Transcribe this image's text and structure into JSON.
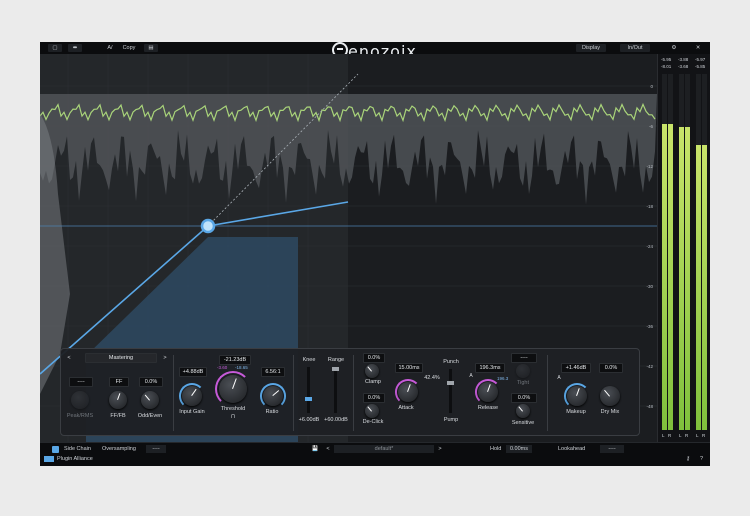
{
  "topbar": {
    "btn1": "▢",
    "btn2": "⬌",
    "ab": "A/",
    "copy": "Copy",
    "btn5": "▤",
    "display": "Display",
    "inout": "In/Out",
    "gear": "⚙",
    "close": "✕"
  },
  "logo": {
    "text": "enozoix"
  },
  "meters": {
    "top_values": [
      "-5.95",
      "-3.88",
      "-5.97"
    ],
    "sub_values": [
      "-8.01",
      "-3.68",
      "-5.85"
    ],
    "levels": [
      0.86,
      0.85,
      0.8
    ],
    "bottom_labels": [
      "L",
      "R",
      "L",
      "R",
      "L",
      "R"
    ]
  },
  "axis": {
    "right_labels": [
      "0",
      "-6",
      "-12",
      "-18",
      "-24",
      "-30",
      "-36",
      "-42",
      "-48"
    ]
  },
  "mastering": {
    "preset": "Mastering",
    "prev": "<",
    "next": ">"
  },
  "controls": {
    "peak_rms_val": "----",
    "peak_rms": "Peak/RMS",
    "ff_fb_val": "FF",
    "ff_fb": "FF/FB",
    "odd_even_val": "0.0%",
    "odd_even": "Odd/Even",
    "input_gain_val": "+4.88dB",
    "input_gain": "Input Gain",
    "threshold_val": "-21.23dB",
    "threshold_sub_a": "-3.60",
    "threshold_sub_b": "-18.65",
    "threshold": "Threshold",
    "threshold_icon": "⊓",
    "ratio_val": "6.56:1",
    "ratio": "Ratio",
    "knee": "Knee",
    "knee_val": "+6.00dB",
    "range": "Range",
    "range_val": "+60.00dB",
    "clamp_val": "0.0%",
    "clamp": "Clamp",
    "declick_val": "0.0%",
    "declick": "De-Click",
    "attack_val": "15.00ms",
    "attack": "Attack",
    "punch": "Punch",
    "pump_val": "42.4%",
    "pump": "Pump",
    "release_val": "196.3ms",
    "release_sub": "196.3",
    "release": "Release",
    "tight_val": "----",
    "tight": "Tight",
    "sensitive_val": "0.0%",
    "sensitive": "Sensitive",
    "makeup_val": "+1.46dB",
    "makeup": "Makeup",
    "drymix_val": "0.0%",
    "drymix": "Dry Mix",
    "auto_a": "A",
    "auto_b": "A"
  },
  "bottombar": {
    "sidechain": "Side Chain",
    "oversampling": "Oversampling",
    "os_val": "----",
    "preset": "default*",
    "hold": "Hold",
    "hold_val": "0.00ms",
    "lookahead": "Lookahead",
    "la_val": "----",
    "brand": "Plugin Alliance",
    "key": "⚷",
    "help": "?",
    "save_icon": "💾",
    "prev": "<",
    "next": ">"
  },
  "colors": {
    "accent": "#5aa7e6",
    "wave": "#a9d47a",
    "purple": "#c65ad8"
  }
}
